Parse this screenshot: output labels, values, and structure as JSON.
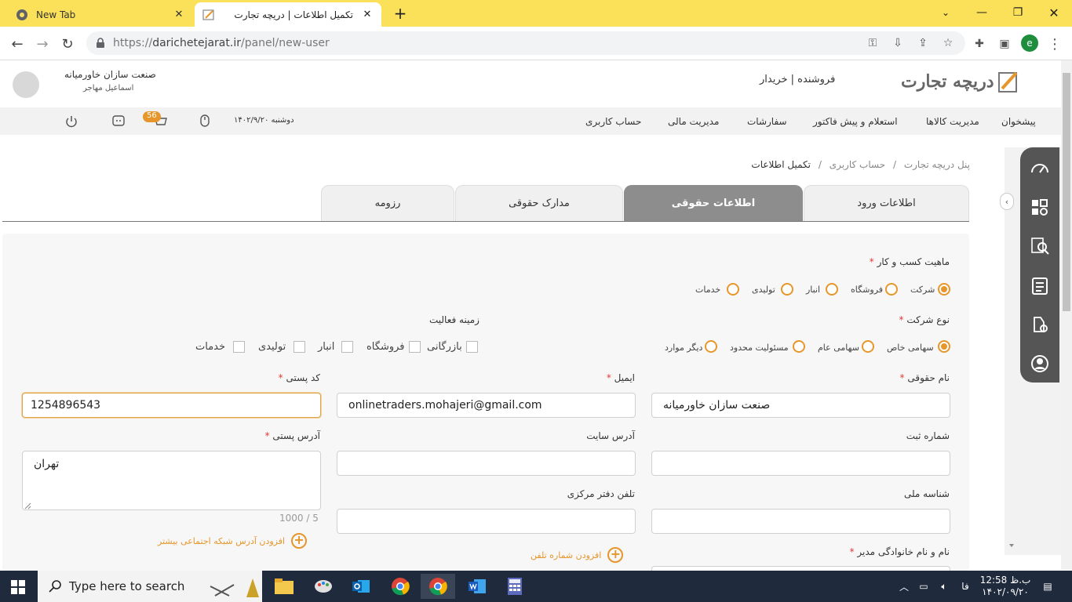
{
  "browser": {
    "tabs": [
      {
        "title": "New Tab"
      },
      {
        "title": "تکمیل اطلاعات | دریچه تجارت"
      }
    ],
    "url_domain": "darichetejarat.ir",
    "url_path": "/panel/new-user",
    "url_scheme": "https://",
    "new_tab_symbol": "+",
    "profile_initial": "e"
  },
  "header": {
    "logo_text": "دریچه تجارت",
    "role_switch": "فروشنده | خریدار",
    "company_name": "صنعت سازان خاورمیانه",
    "user_name": "اسماعیل مهاجر"
  },
  "menu": {
    "items": [
      "پیشخوان",
      "مدیریت کالاها",
      "استعلام و پیش فاکتور",
      "سفارشات",
      "مدیریت مالی",
      "حساب کاربری"
    ],
    "date": "دوشنبه ۱۴۰۲/۹/۲۰",
    "notification_count": "56"
  },
  "breadcrumb": {
    "items": [
      "پنل دریچه تجارت",
      "حساب کاربری",
      "تکمیل اطلاعات"
    ],
    "separator": "/"
  },
  "form_tabs": [
    "اطلاعات ورود",
    "اطلاعات حقوقی",
    "مدارک حقوقی",
    "رزومه"
  ],
  "form": {
    "business_nature_label": "ماهیت کسب و کار",
    "business_nature_options": [
      "شرکت",
      "فروشگاه",
      "انبار",
      "تولیدی",
      "خدمات"
    ],
    "company_type_label": "نوع شرکت",
    "company_type_options": [
      "سهامی خاص",
      "سهامی عام",
      "مسئولیت محدود",
      "دیگر موارد"
    ],
    "activity_label": "زمینه فعالیت",
    "activity_options": [
      "بازرگانی",
      "فروشگاه",
      "انبار",
      "تولیدی",
      "خدمات"
    ],
    "legal_name_label": "نام حقوقی",
    "legal_name_value": "صنعت سازان خاورمیانه",
    "email_label": "ایمیل",
    "email_value": "onlinetraders.mohajeri@gmail.com",
    "postal_code_label": "کد پستی",
    "postal_code_value": "1254896543",
    "registration_label": "شماره ثبت",
    "website_label": "آدرس سایت",
    "postal_address_label": "آدرس پستی",
    "postal_address_value": "تهران",
    "char_counter": "1000 / 5",
    "national_id_label": "شناسه ملی",
    "office_phone_label": "تلفن دفتر مرکزی",
    "add_social_link": "افزودن آدرس شبکه اجتماعی بیشتر",
    "add_phone_link": "افزودن شماره تلفن",
    "manager_name_label": "نام و نام خانوادگی مدیر",
    "required_mark": "*"
  },
  "taskbar": {
    "search_placeholder": "Type here to search",
    "lang": "فا",
    "time": "12:58 ب.ظ",
    "date": "۱۴۰۲/۰۹/۲۰"
  },
  "colors": {
    "accent": "#e6962a",
    "tab_active": "#8d8d8d",
    "chrome_tabbar": "#fbe05a",
    "taskbar": "#1f2a3c"
  }
}
